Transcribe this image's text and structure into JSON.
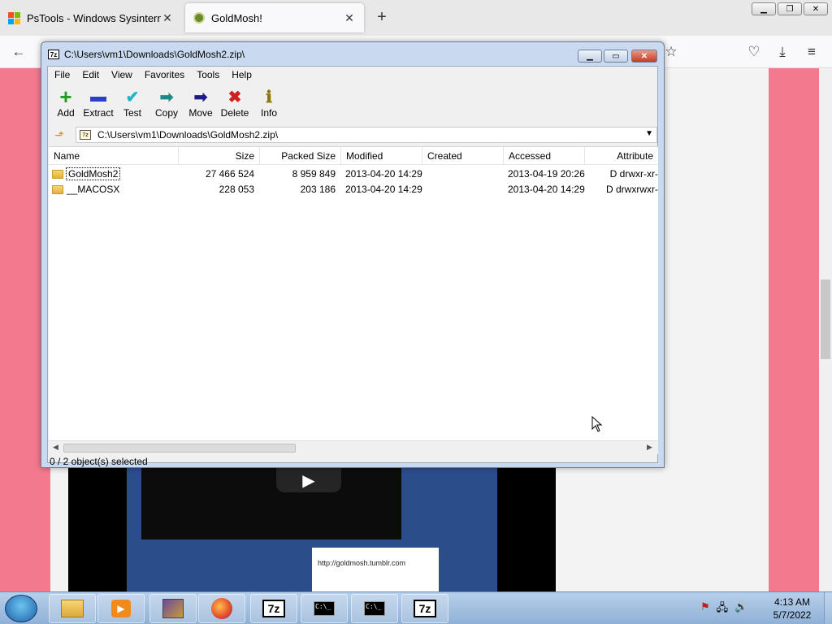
{
  "browser": {
    "tabs": [
      {
        "title": "PsTools - Windows Sysinternals",
        "close": "✕"
      },
      {
        "title": "GoldMosh!",
        "close": "✕"
      }
    ],
    "new_tab": "+"
  },
  "video": {
    "play_symbol": "▶",
    "url_text": "http://goldmosh.tumblr.com"
  },
  "zip_window": {
    "title": "C:\\Users\\vm1\\Downloads\\GoldMosh2.zip\\",
    "logo": "7z",
    "menu": [
      "File",
      "Edit",
      "View",
      "Favorites",
      "Tools",
      "Help"
    ],
    "toolbar": [
      {
        "label": "Add",
        "icon": "+",
        "color": "#1aa31a"
      },
      {
        "label": "Extract",
        "icon": "▬",
        "color": "#2a3fc4"
      },
      {
        "label": "Test",
        "icon": "✔",
        "color": "#22b5c8"
      },
      {
        "label": "Copy",
        "icon": "➡",
        "color": "#1a8a8a"
      },
      {
        "label": "Move",
        "icon": "➡",
        "color": "#1a1a8a"
      },
      {
        "label": "Delete",
        "icon": "✖",
        "color": "#d01f1f"
      },
      {
        "label": "Info",
        "icon": "ℹ",
        "color": "#8a7a00"
      }
    ],
    "path": "C:\\Users\\vm1\\Downloads\\GoldMosh2.zip\\",
    "columns": [
      "Name",
      "Size",
      "Packed Size",
      "Modified",
      "Created",
      "Accessed",
      "Attribute"
    ],
    "rows": [
      {
        "name": "GoldMosh2",
        "size": "27 466 524",
        "packed": "8 959 849",
        "modified": "2013-04-20 14:29",
        "created": "",
        "accessed": "2013-04-19 20:26",
        "attr": "D drwxr-xr-"
      },
      {
        "name": "__MACOSX",
        "size": "228 053",
        "packed": "203 186",
        "modified": "2013-04-20 14:29",
        "created": "",
        "accessed": "2013-04-20 14:29",
        "attr": "D drwxrwxr-"
      }
    ],
    "status": "0 / 2 object(s) selected"
  },
  "taskbar": {
    "time": "4:13 AM",
    "date": "5/7/2022",
    "cmd_label": "C:\\_",
    "zip_label": "7z"
  }
}
